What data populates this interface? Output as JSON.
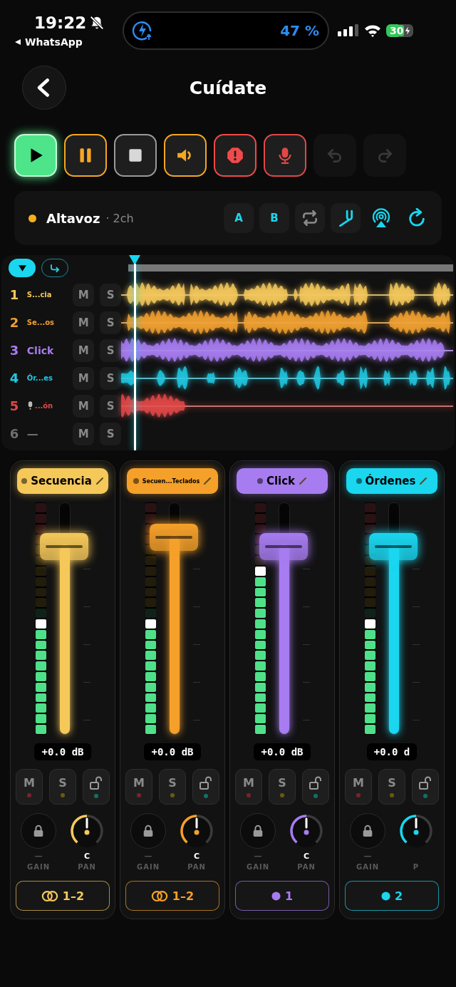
{
  "status_bar": {
    "time": "19:22",
    "back_app": "WhatsApp",
    "charge_text": "47 %",
    "battery": "30"
  },
  "header": {
    "title": "Cuídate"
  },
  "transport": [
    {
      "kind": "play",
      "active": true,
      "disabled": false
    },
    {
      "kind": "pause",
      "active": false,
      "disabled": false
    },
    {
      "kind": "stop",
      "active": false,
      "disabled": false
    },
    {
      "kind": "volume",
      "active": false,
      "disabled": false
    },
    {
      "kind": "alert",
      "active": false,
      "disabled": false
    },
    {
      "kind": "mic",
      "active": false,
      "disabled": false
    },
    {
      "kind": "undo",
      "active": false,
      "disabled": true
    },
    {
      "kind": "redo",
      "active": false,
      "disabled": true
    }
  ],
  "output": {
    "name": "Altavoz",
    "channels": "· 2ch",
    "buttons": [
      {
        "kind": "text",
        "label": "A",
        "on": true
      },
      {
        "kind": "text",
        "label": "B",
        "on": true
      },
      {
        "kind": "loop",
        "on": false
      },
      {
        "kind": "tuner",
        "on": true
      },
      {
        "kind": "airplay",
        "on": true
      },
      {
        "kind": "refresh",
        "on": true
      }
    ]
  },
  "tracks": [
    {
      "number": "1",
      "name": "S...cia",
      "kind": "audio",
      "color": "#f5c85a",
      "mute": "M",
      "solo": "S"
    },
    {
      "number": "2",
      "name": "Se...os",
      "kind": "audio",
      "color": "#f0a030",
      "mute": "M",
      "solo": "S"
    },
    {
      "number": "3",
      "name": "Click",
      "kind": "audio",
      "color": "#a77cf0",
      "mute": "M",
      "solo": "S"
    },
    {
      "number": "4",
      "name": "Ór...es",
      "kind": "audio",
      "color": "#20c8e0",
      "mute": "M",
      "solo": "S"
    },
    {
      "number": "5",
      "name": "...ón",
      "kind": "input",
      "color": "#e04848",
      "mute": "M",
      "solo": "S"
    },
    {
      "number": "6",
      "name": "—",
      "kind": "empty",
      "color": "#707070",
      "mute": "M",
      "solo": "S"
    }
  ],
  "strips": [
    {
      "name": "Secuencia",
      "color": "#f5c85a",
      "fader": {
        "level": 0.82
      },
      "meter": {
        "level": 0.45
      },
      "peak": {
        "level": 0.5
      },
      "gain_db": "+0.0 dB",
      "mute": "M",
      "solo": "S",
      "gain_value": "—",
      "gain_label": "GAIN",
      "pan_value": "C",
      "pan_label": "PAN",
      "route": {
        "kind": "stereo",
        "label": "1–2"
      }
    },
    {
      "name": "Secuen...Teclados",
      "color": "#f5a02a",
      "fader": {
        "level": 0.86
      },
      "meter": {
        "level": 0.45
      },
      "peak": {
        "level": 0.5
      },
      "gain_db": "+0.0 dB",
      "mute": "M",
      "solo": "S",
      "gain_value": "—",
      "gain_label": "GAIN",
      "pan_value": "C",
      "pan_label": "PAN",
      "route": {
        "kind": "stereo",
        "label": "1–2"
      }
    },
    {
      "name": "Click",
      "color": "#a77cf0",
      "fader": {
        "level": 0.82
      },
      "meter": {
        "level": 0.68
      },
      "peak": {
        "level": 0.73
      },
      "gain_db": "+0.0 dB",
      "mute": "M",
      "solo": "S",
      "gain_value": "—",
      "gain_label": "GAIN",
      "pan_value": "C",
      "pan_label": "PAN",
      "route": {
        "kind": "mono",
        "label": "1"
      }
    },
    {
      "name": "Órdenes",
      "color": "#1ad6ef",
      "fader": {
        "level": 0.82
      },
      "meter": {
        "level": 0.45
      },
      "peak": {
        "level": 0.5
      },
      "gain_db": "+0.0 d",
      "mute": "M",
      "solo": "S",
      "gain_value": "—",
      "gain_label": "GAIN",
      "pan_label": "P",
      "route": {
        "kind": "mono",
        "label": "2"
      }
    }
  ]
}
